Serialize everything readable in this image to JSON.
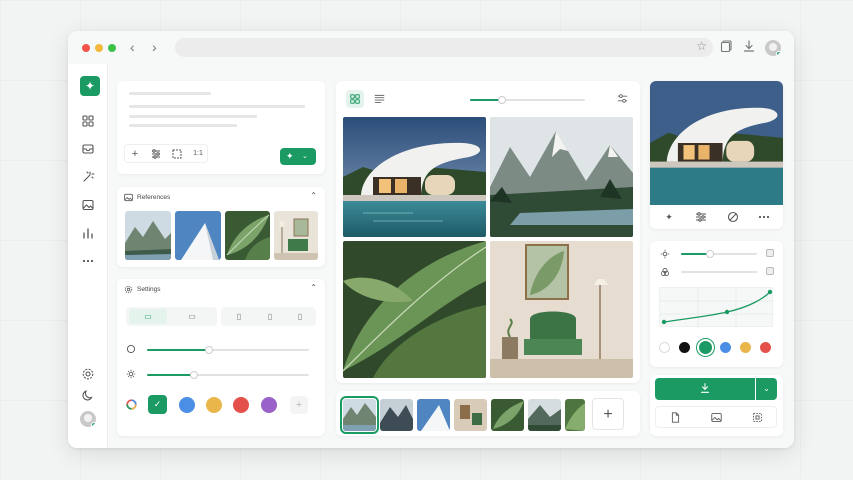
{
  "panels": {
    "references": {
      "title": "References"
    },
    "settings": {
      "title": "Settings"
    }
  },
  "prompt_tools": {
    "count_label": "1:1"
  },
  "icons": {
    "logo": "sparkle-icon",
    "sidebar": [
      "grid-icon",
      "inbox-icon",
      "magic-wand-icon",
      "image-icon",
      "bar-chart-icon",
      "more-icon",
      "settings-icon",
      "moon-icon"
    ],
    "right_tools": [
      "sparkle-icon",
      "sliders-icon",
      "ban-icon",
      "more-icon"
    ],
    "export": [
      "file-icon",
      "image-icon",
      "crop-icon"
    ]
  },
  "colors": {
    "accent": "#1b9a64",
    "palette": [
      "#1b9a64",
      "#4a8ee6",
      "#e8b64b",
      "#e4504a",
      "#9a62c9"
    ],
    "mini_palette": [
      "#ffffff",
      "#111111",
      "#1b9a64",
      "#4a8ee6",
      "#e8b64b",
      "#e4504a"
    ]
  },
  "sliders": {
    "settings_1": 0.38,
    "settings_2": 0.29,
    "view_zoom": 0.28,
    "right_1": 0.38,
    "right_2": 0.0
  }
}
